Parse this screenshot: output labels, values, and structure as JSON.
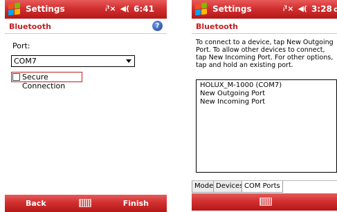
{
  "left_screen": {
    "titlebar": {
      "title": "Settings",
      "signal_icon": "signal-icon",
      "volume_icon": "volume-icon",
      "time": "6:41"
    },
    "header": {
      "title": "Bluetooth",
      "help_icon": "help-icon"
    },
    "port": {
      "label": "Port:",
      "value": "COM7"
    },
    "secure": {
      "label": "Secure Connection",
      "checked": false
    },
    "softkeys": {
      "left": "Back",
      "right": "Finish",
      "keyboard_icon": "keyboard-icon"
    }
  },
  "right_screen": {
    "titlebar": {
      "title": "Settings",
      "signal_icon": "signal-icon",
      "volume_icon": "volume-icon",
      "time": "3:28",
      "ok": "o"
    },
    "header": {
      "title": "Bluetooth"
    },
    "instructions": "To connect to a device, tap New Outgoing Port. To allow other devices to connect, tap New Incoming Port. For other options, tap and hold an existing port.",
    "ports": [
      "HOLUX_M-1000 (COM7)",
      "New Outgoing Port",
      "New Incoming Port"
    ],
    "tabs": [
      {
        "label": "Mode",
        "active": false
      },
      {
        "label": "Devices",
        "active": false
      },
      {
        "label": "COM Ports",
        "active": true
      }
    ],
    "keyboard_icon": "keyboard-icon"
  },
  "colors": {
    "titlebar_red": "#d23030",
    "header_text_red": "#c41e1e"
  }
}
